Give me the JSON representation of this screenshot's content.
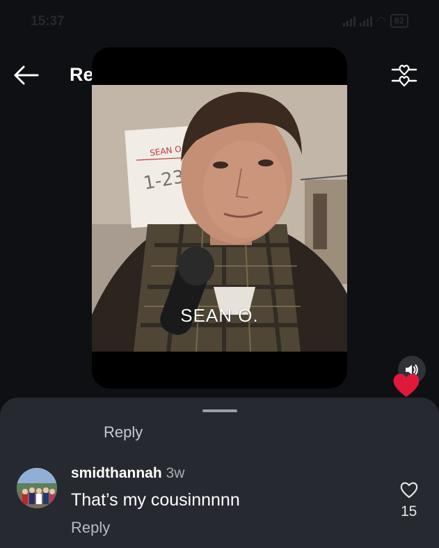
{
  "status_bar": {
    "time": "15:37",
    "battery": "82"
  },
  "header": {
    "title": "Reels"
  },
  "reel": {
    "caption": "SEAN O.",
    "sign_name": "SEAN O",
    "sign_number": "1-23"
  },
  "sheet": {
    "reply_label": "Reply"
  },
  "comment": {
    "username": "smidthannah",
    "time_ago": "3w",
    "text": "That’s my cousinnnnn",
    "reply_label": "Reply",
    "like_count": "15"
  },
  "colors": {
    "background": "#0e1013",
    "sheet": "#26292f",
    "heart": "#e0183c"
  }
}
